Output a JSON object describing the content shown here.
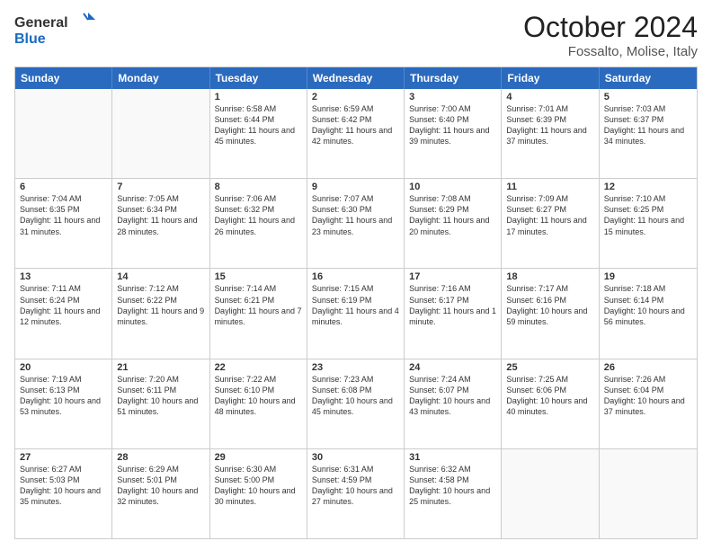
{
  "header": {
    "logo_general": "General",
    "logo_blue": "Blue",
    "month": "October 2024",
    "location": "Fossalto, Molise, Italy"
  },
  "days": [
    "Sunday",
    "Monday",
    "Tuesday",
    "Wednesday",
    "Thursday",
    "Friday",
    "Saturday"
  ],
  "weeks": [
    [
      {
        "day": "",
        "sunrise": "",
        "sunset": "",
        "daylight": ""
      },
      {
        "day": "",
        "sunrise": "",
        "sunset": "",
        "daylight": ""
      },
      {
        "day": "1",
        "sunrise": "Sunrise: 6:58 AM",
        "sunset": "Sunset: 6:44 PM",
        "daylight": "Daylight: 11 hours and 45 minutes."
      },
      {
        "day": "2",
        "sunrise": "Sunrise: 6:59 AM",
        "sunset": "Sunset: 6:42 PM",
        "daylight": "Daylight: 11 hours and 42 minutes."
      },
      {
        "day": "3",
        "sunrise": "Sunrise: 7:00 AM",
        "sunset": "Sunset: 6:40 PM",
        "daylight": "Daylight: 11 hours and 39 minutes."
      },
      {
        "day": "4",
        "sunrise": "Sunrise: 7:01 AM",
        "sunset": "Sunset: 6:39 PM",
        "daylight": "Daylight: 11 hours and 37 minutes."
      },
      {
        "day": "5",
        "sunrise": "Sunrise: 7:03 AM",
        "sunset": "Sunset: 6:37 PM",
        "daylight": "Daylight: 11 hours and 34 minutes."
      }
    ],
    [
      {
        "day": "6",
        "sunrise": "Sunrise: 7:04 AM",
        "sunset": "Sunset: 6:35 PM",
        "daylight": "Daylight: 11 hours and 31 minutes."
      },
      {
        "day": "7",
        "sunrise": "Sunrise: 7:05 AM",
        "sunset": "Sunset: 6:34 PM",
        "daylight": "Daylight: 11 hours and 28 minutes."
      },
      {
        "day": "8",
        "sunrise": "Sunrise: 7:06 AM",
        "sunset": "Sunset: 6:32 PM",
        "daylight": "Daylight: 11 hours and 26 minutes."
      },
      {
        "day": "9",
        "sunrise": "Sunrise: 7:07 AM",
        "sunset": "Sunset: 6:30 PM",
        "daylight": "Daylight: 11 hours and 23 minutes."
      },
      {
        "day": "10",
        "sunrise": "Sunrise: 7:08 AM",
        "sunset": "Sunset: 6:29 PM",
        "daylight": "Daylight: 11 hours and 20 minutes."
      },
      {
        "day": "11",
        "sunrise": "Sunrise: 7:09 AM",
        "sunset": "Sunset: 6:27 PM",
        "daylight": "Daylight: 11 hours and 17 minutes."
      },
      {
        "day": "12",
        "sunrise": "Sunrise: 7:10 AM",
        "sunset": "Sunset: 6:25 PM",
        "daylight": "Daylight: 11 hours and 15 minutes."
      }
    ],
    [
      {
        "day": "13",
        "sunrise": "Sunrise: 7:11 AM",
        "sunset": "Sunset: 6:24 PM",
        "daylight": "Daylight: 11 hours and 12 minutes."
      },
      {
        "day": "14",
        "sunrise": "Sunrise: 7:12 AM",
        "sunset": "Sunset: 6:22 PM",
        "daylight": "Daylight: 11 hours and 9 minutes."
      },
      {
        "day": "15",
        "sunrise": "Sunrise: 7:14 AM",
        "sunset": "Sunset: 6:21 PM",
        "daylight": "Daylight: 11 hours and 7 minutes."
      },
      {
        "day": "16",
        "sunrise": "Sunrise: 7:15 AM",
        "sunset": "Sunset: 6:19 PM",
        "daylight": "Daylight: 11 hours and 4 minutes."
      },
      {
        "day": "17",
        "sunrise": "Sunrise: 7:16 AM",
        "sunset": "Sunset: 6:17 PM",
        "daylight": "Daylight: 11 hours and 1 minute."
      },
      {
        "day": "18",
        "sunrise": "Sunrise: 7:17 AM",
        "sunset": "Sunset: 6:16 PM",
        "daylight": "Daylight: 10 hours and 59 minutes."
      },
      {
        "day": "19",
        "sunrise": "Sunrise: 7:18 AM",
        "sunset": "Sunset: 6:14 PM",
        "daylight": "Daylight: 10 hours and 56 minutes."
      }
    ],
    [
      {
        "day": "20",
        "sunrise": "Sunrise: 7:19 AM",
        "sunset": "Sunset: 6:13 PM",
        "daylight": "Daylight: 10 hours and 53 minutes."
      },
      {
        "day": "21",
        "sunrise": "Sunrise: 7:20 AM",
        "sunset": "Sunset: 6:11 PM",
        "daylight": "Daylight: 10 hours and 51 minutes."
      },
      {
        "day": "22",
        "sunrise": "Sunrise: 7:22 AM",
        "sunset": "Sunset: 6:10 PM",
        "daylight": "Daylight: 10 hours and 48 minutes."
      },
      {
        "day": "23",
        "sunrise": "Sunrise: 7:23 AM",
        "sunset": "Sunset: 6:08 PM",
        "daylight": "Daylight: 10 hours and 45 minutes."
      },
      {
        "day": "24",
        "sunrise": "Sunrise: 7:24 AM",
        "sunset": "Sunset: 6:07 PM",
        "daylight": "Daylight: 10 hours and 43 minutes."
      },
      {
        "day": "25",
        "sunrise": "Sunrise: 7:25 AM",
        "sunset": "Sunset: 6:06 PM",
        "daylight": "Daylight: 10 hours and 40 minutes."
      },
      {
        "day": "26",
        "sunrise": "Sunrise: 7:26 AM",
        "sunset": "Sunset: 6:04 PM",
        "daylight": "Daylight: 10 hours and 37 minutes."
      }
    ],
    [
      {
        "day": "27",
        "sunrise": "Sunrise: 6:27 AM",
        "sunset": "Sunset: 5:03 PM",
        "daylight": "Daylight: 10 hours and 35 minutes."
      },
      {
        "day": "28",
        "sunrise": "Sunrise: 6:29 AM",
        "sunset": "Sunset: 5:01 PM",
        "daylight": "Daylight: 10 hours and 32 minutes."
      },
      {
        "day": "29",
        "sunrise": "Sunrise: 6:30 AM",
        "sunset": "Sunset: 5:00 PM",
        "daylight": "Daylight: 10 hours and 30 minutes."
      },
      {
        "day": "30",
        "sunrise": "Sunrise: 6:31 AM",
        "sunset": "Sunset: 4:59 PM",
        "daylight": "Daylight: 10 hours and 27 minutes."
      },
      {
        "day": "31",
        "sunrise": "Sunrise: 6:32 AM",
        "sunset": "Sunset: 4:58 PM",
        "daylight": "Daylight: 10 hours and 25 minutes."
      },
      {
        "day": "",
        "sunrise": "",
        "sunset": "",
        "daylight": ""
      },
      {
        "day": "",
        "sunrise": "",
        "sunset": "",
        "daylight": ""
      }
    ]
  ]
}
